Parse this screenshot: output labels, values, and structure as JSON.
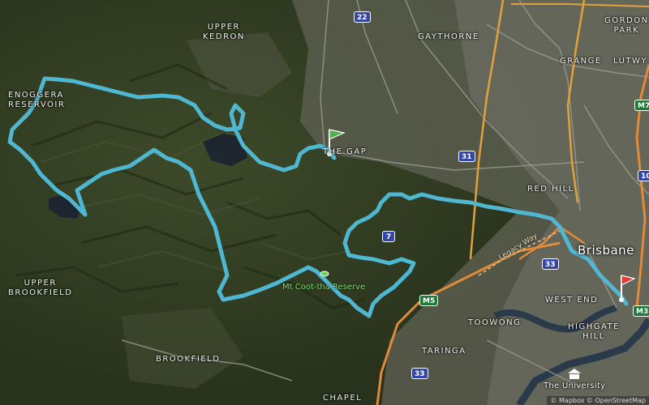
{
  "map": {
    "place_labels": [
      {
        "id": "upper-kedron",
        "lines": [
          "UPPER",
          "KEDRON"
        ]
      },
      {
        "id": "gaythorne",
        "lines": [
          "GAYTHORNE"
        ]
      },
      {
        "id": "gordon-park",
        "lines": [
          "GORDON",
          "PARK"
        ]
      },
      {
        "id": "grange",
        "lines": [
          "GRANGE"
        ]
      },
      {
        "id": "lutwyche",
        "lines": [
          "LUTWY"
        ]
      },
      {
        "id": "enoggera-reservoir",
        "lines": [
          "ENOGGERA",
          "RESERVOIR"
        ]
      },
      {
        "id": "the-gap",
        "lines": [
          "THE GAP"
        ]
      },
      {
        "id": "red-hill",
        "lines": [
          "RED HILL"
        ]
      },
      {
        "id": "upper-brookfield",
        "lines": [
          "UPPER",
          "BROOKFIELD"
        ]
      },
      {
        "id": "west-end",
        "lines": [
          "WEST END"
        ]
      },
      {
        "id": "highgate-hill",
        "lines": [
          "HIGHGATE",
          "HILL"
        ]
      },
      {
        "id": "toowong",
        "lines": [
          "TOOWONG"
        ]
      },
      {
        "id": "taringa",
        "lines": [
          "TARINGA"
        ]
      },
      {
        "id": "brookfield",
        "lines": [
          "BROOKFIELD"
        ]
      },
      {
        "id": "chapel",
        "lines": [
          "CHAPEL"
        ]
      },
      {
        "id": "the-university",
        "lines": [
          "The University"
        ]
      }
    ],
    "city_label": "Brisbane",
    "park_label": "Mt Coot-tha Reserve",
    "road_label": "Legacy Way",
    "shields": [
      {
        "id": "route-22",
        "text": "22",
        "color": "blue"
      },
      {
        "id": "route-31",
        "text": "31",
        "color": "blue"
      },
      {
        "id": "route-7",
        "text": "7",
        "color": "blue"
      },
      {
        "id": "route-33-a",
        "text": "33",
        "color": "blue"
      },
      {
        "id": "route-33-b",
        "text": "33",
        "color": "blue"
      },
      {
        "id": "route-m5",
        "text": "M5",
        "color": "green"
      },
      {
        "id": "route-m7",
        "text": "M7",
        "color": "green"
      },
      {
        "id": "route-m3",
        "text": "M3",
        "color": "green"
      },
      {
        "id": "route-10",
        "text": "10",
        "color": "blue"
      }
    ],
    "attribution": "© Mapbox © OpenStreetMap",
    "start_marker": {
      "type": "start-flag",
      "color": "#4caf50"
    },
    "end_marker": {
      "type": "finish-flag",
      "color": "#e53935"
    },
    "route_color": "#4fb7d1"
  }
}
